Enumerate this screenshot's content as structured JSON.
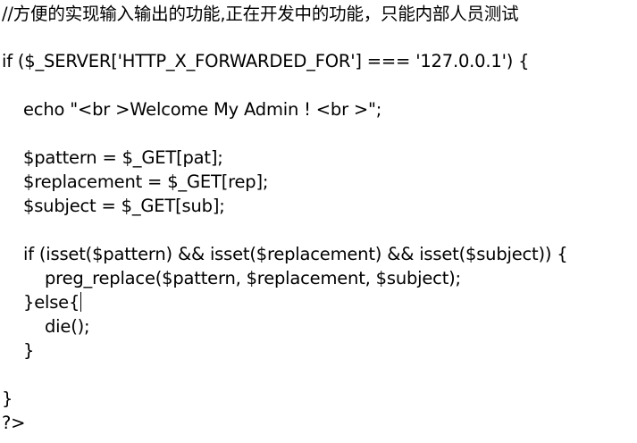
{
  "code": {
    "lines": [
      "//方便的实现输入输出的功能,正在开发中的功能，只能内部人员测试",
      "if ($_SERVER['HTTP_X_FORWARDED_FOR'] === '127.0.0.1') {",
      "echo \"<br >Welcome My Admin ! <br >\";",
      "$pattern = $_GET[pat];",
      "$replacement = $_GET[rep];",
      "$subject = $_GET[sub];",
      "if (isset($pattern) && isset($replacement) && isset($subject)) {",
      "preg_replace($pattern, $replacement, $subject);",
      "}else{",
      "die();",
      "}",
      "}",
      "?>"
    ]
  }
}
